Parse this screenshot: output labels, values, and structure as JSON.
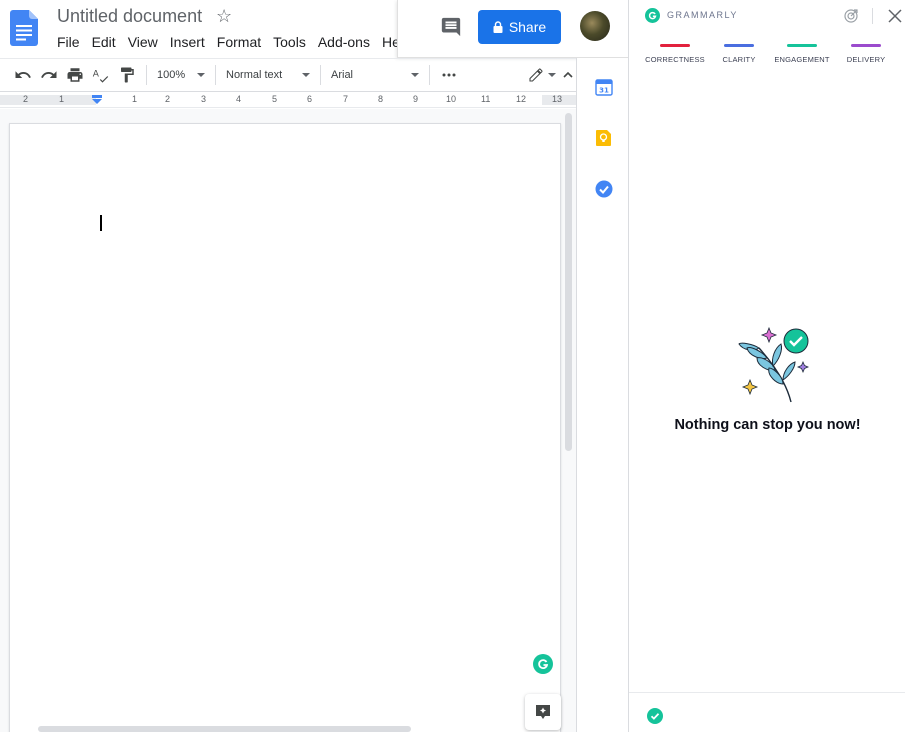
{
  "document": {
    "title": "Untitled document",
    "menu": [
      "File",
      "Edit",
      "View",
      "Insert",
      "Format",
      "Tools",
      "Add-ons",
      "He"
    ]
  },
  "header": {
    "share_label": "Share"
  },
  "toolbar": {
    "zoom": "100%",
    "style": "Normal text",
    "font": "Arial"
  },
  "ruler": {
    "ticks": [
      "2",
      "1",
      "1",
      "2",
      "3",
      "4",
      "5",
      "6",
      "7",
      "8",
      "9",
      "10",
      "11",
      "12",
      "13"
    ]
  },
  "grammarly": {
    "title": "GRAMMARLY",
    "categories": [
      {
        "label": "CORRECTNESS",
        "color": "#e2213d"
      },
      {
        "label": "CLARITY",
        "color": "#4a6ee0"
      },
      {
        "label": "ENGAGEMENT",
        "color": "#15c39a"
      },
      {
        "label": "DELIVERY",
        "color": "#9b4bcd"
      }
    ],
    "message": "Nothing can stop you now!"
  },
  "colors": {
    "accent_blue": "#1a73e8",
    "grammarly_green": "#15c39a"
  }
}
